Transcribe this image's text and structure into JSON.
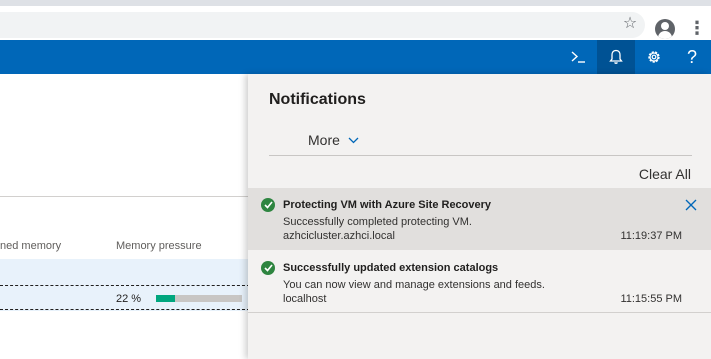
{
  "browser": {
    "star_glyph": "☆",
    "menu_glyph": "⋮",
    "icons": [
      "bookmark-star-icon",
      "profile-icon",
      "menu-icon"
    ]
  },
  "header": {
    "accent": "#0067b8",
    "buttons": [
      {
        "name": "terminal-button",
        "icon": "terminal-icon"
      },
      {
        "name": "notifications-button",
        "icon": "bell-icon",
        "active": true
      },
      {
        "name": "settings-button",
        "icon": "gear-icon"
      },
      {
        "name": "help-button",
        "icon": "help-icon",
        "glyph": "?"
      }
    ]
  },
  "background": {
    "columns": [
      "ned memory",
      "Memory pressure"
    ],
    "row": {
      "memory_pressure": "22 %",
      "memory_pressure_value": 0.22
    }
  },
  "notifications": {
    "title": "Notifications",
    "more_label": "More",
    "clear_all_label": "Clear All",
    "status_color": "#2e8540",
    "items": [
      {
        "title": "Protecting VM with Azure Site Recovery",
        "message": "Successfully completed protecting VM.",
        "source": "azhcicluster.azhci.local",
        "time": "11:19:37 PM",
        "status": "success",
        "dismissible": true
      },
      {
        "title": "Successfully updated extension catalogs",
        "message": "You can now view and manage extensions and feeds.",
        "source": "localhost",
        "time": "11:15:55 PM",
        "status": "success"
      }
    ]
  }
}
